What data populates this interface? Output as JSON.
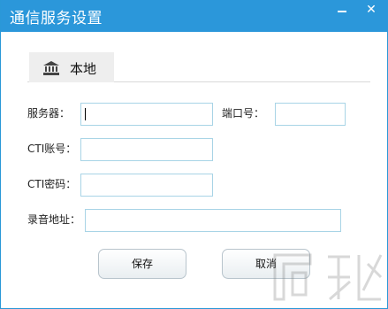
{
  "window": {
    "title": "通信服务设置"
  },
  "titlebar_buttons": {
    "minimize_icon": "minimize-icon",
    "close_label": "✕"
  },
  "tab": {
    "label": "本地",
    "icon": "bank-icon"
  },
  "form": {
    "server_label": "服务器：",
    "server_value": "",
    "port_label": "端口号：",
    "port_value": "",
    "cti_account_label": "CTI账号：",
    "cti_account_value": "",
    "cti_password_label": "CTI密码：",
    "cti_password_value": "",
    "record_address_label": "录音地址：",
    "record_address_value": ""
  },
  "actions": {
    "save_label": "保存",
    "cancel_label": "取消"
  },
  "colors": {
    "title_bar": "#2b97da",
    "input_border": "#a8d4e6",
    "tab_bg": "#eeeeee"
  }
}
